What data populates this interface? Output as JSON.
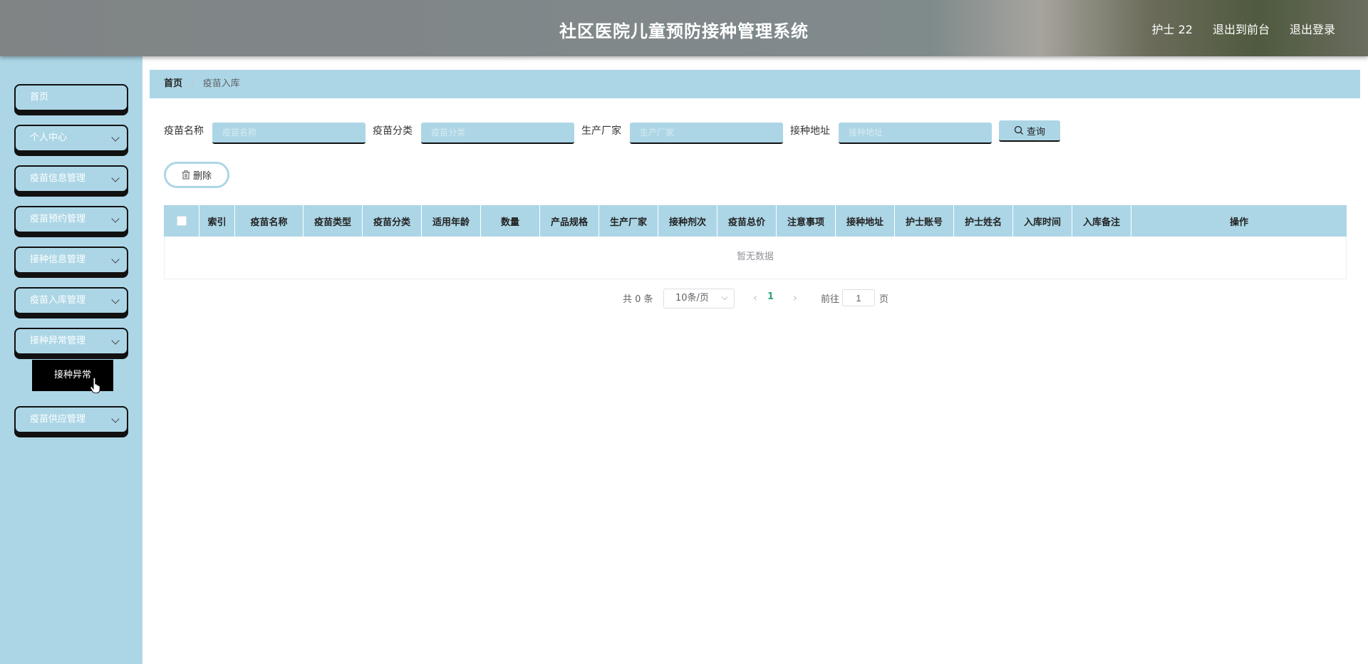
{
  "header": {
    "title": "社区医院儿童预防接种管理系统",
    "user": "护士 22",
    "to_front": "退出到前台",
    "logout": "退出登录"
  },
  "sidebar": {
    "items": [
      {
        "label": "首页"
      },
      {
        "label": "个人中心"
      },
      {
        "label": "疫苗信息管理"
      },
      {
        "label": "疫苗预约管理"
      },
      {
        "label": "接种信息管理"
      },
      {
        "label": "疫苗入库管理"
      },
      {
        "label": "接种异常管理"
      },
      {
        "label": "疫苗供应管理"
      }
    ],
    "submenu_item": "接种异常"
  },
  "breadcrumb": {
    "home": "首页",
    "separator": "/",
    "current": "疫苗入库"
  },
  "search": {
    "fields": [
      {
        "label": "疫苗名称",
        "placeholder": "疫苗名称",
        "value": ""
      },
      {
        "label": "疫苗分类",
        "placeholder": "疫苗分类",
        "value": ""
      },
      {
        "label": "生产厂家",
        "placeholder": "生产厂家",
        "value": ""
      },
      {
        "label": "接种地址",
        "placeholder": "接种地址",
        "value": ""
      }
    ],
    "query_label": "查询"
  },
  "actions": {
    "delete_label": "删除"
  },
  "table": {
    "columns": [
      "索引",
      "疫苗名称",
      "疫苗类型",
      "疫苗分类",
      "适用年龄",
      "数量",
      "产品规格",
      "生产厂家",
      "接种剂次",
      "疫苗总价",
      "注意事项",
      "接种地址",
      "护士账号",
      "护士姓名",
      "入库时间",
      "入库备注",
      "操作"
    ],
    "empty_text": "暂无数据"
  },
  "pagination": {
    "total_text": "共 0 条",
    "page_size": "10条/页",
    "current_page": "1",
    "goto_label": "前往",
    "goto_value": "1",
    "page_unit": "页"
  },
  "colors": {
    "accent": "#acd6e6",
    "active_page": "#2ea37c"
  }
}
